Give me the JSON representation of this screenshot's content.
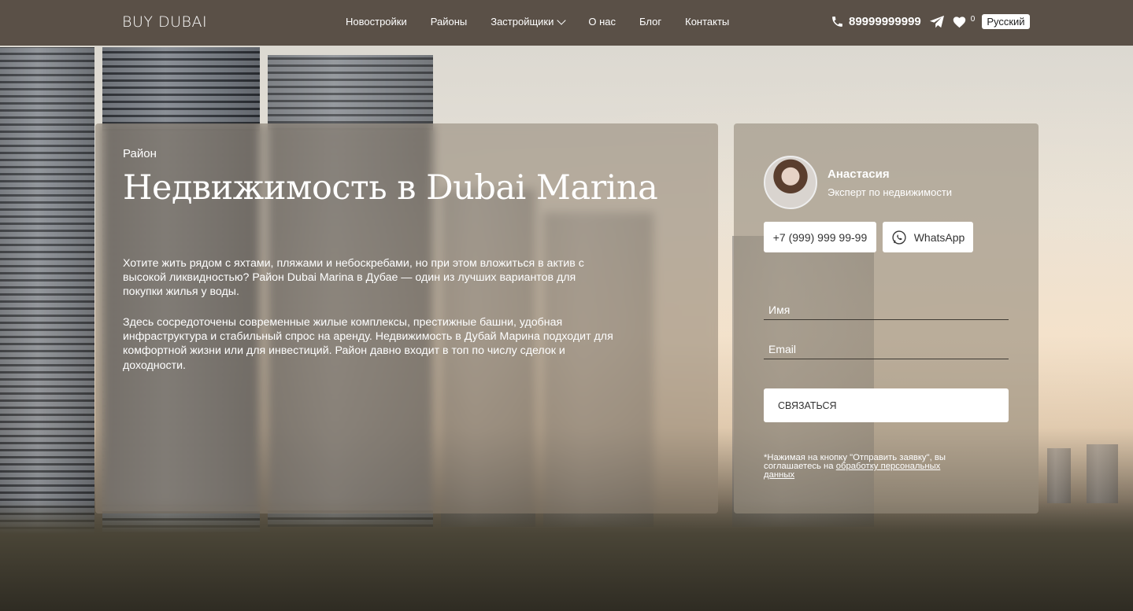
{
  "header": {
    "logo": "BUY DUBAI",
    "nav": [
      "Новостройки",
      "Районы",
      "Застройщики",
      "О нас",
      "Блог",
      "Контакты"
    ],
    "phone": "89999999999",
    "favorites_count": "0",
    "language": "Русский"
  },
  "hero": {
    "label": "Район",
    "title": "Недвижимость в Dubai Marina",
    "paragraph1": "Хотите жить рядом с яхтами, пляжами и небоскребами, но при этом вложиться в актив с высокой ликвидностью? Район Dubai Marina в Дубае — один из лучших вариантов для покупки жилья у воды.",
    "paragraph2": "Здесь сосредоточены современные жилые комплексы, престижные башни, удобная инфраструктура и стабильный спрос на аренду. Недвижимость в Дубай Марина подходит для комфортной жизни или для инвестиций. Район давно входит в топ по числу сделок и доходности."
  },
  "contact": {
    "agent_name": "Анастасия",
    "agent_role": "Эксперт по недвижимости",
    "phone_button": "+7 (999) 999 99-99",
    "whatsapp_button": "WhatsApp",
    "name_placeholder": "Имя",
    "email_placeholder": "Email",
    "submit_button": "СВЯЗАТЬСЯ",
    "disclaimer_text": "*Нажимая на кнопку \"Отправить заявку\", вы соглашаетесь на ",
    "disclaimer_link": "обработку персональных данных"
  },
  "colors": {
    "header_bg": "#5a5047",
    "card_overlay": "#8c8070"
  }
}
